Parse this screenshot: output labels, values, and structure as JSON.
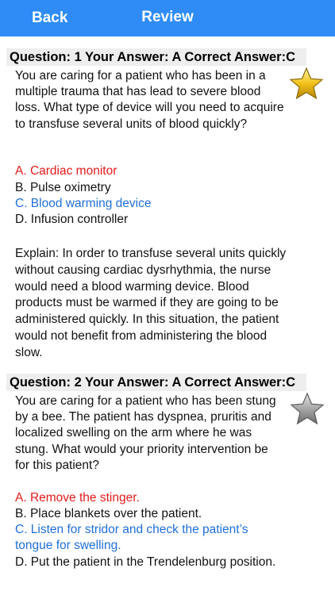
{
  "nav": {
    "back_label": "Back",
    "title": "Review"
  },
  "questions": [
    {
      "header": "Question: 1 Your Answer: A Correct Answer:C",
      "text": "You are caring for a patient who has been in a multiple trauma that has lead to severe blood loss. What type of device will you need to acquire to transfuse several units of blood quickly?",
      "options": [
        {
          "label": "A. Cardiac monitor",
          "state": "wrong"
        },
        {
          "label": "B. Pulse oximetry",
          "state": "neutral"
        },
        {
          "label": "C. Blood warming device",
          "state": "correct"
        },
        {
          "label": "D. Infusion controller",
          "state": "neutral"
        }
      ],
      "explain": "Explain: In order to transfuse several units quickly without causing cardiac dysrhythmia, the nurse would need a blood warming device. Blood products must be warmed if they are going to be administered quickly. In this situation, the patient would not benefit from administering the blood slow.",
      "star": "gold-star-icon"
    },
    {
      "header": "Question: 2 Your Answer: A Correct Answer:C",
      "text": "You are caring for a patient who has been stung by a bee. The patient has dyspnea, pruritis and localized swelling on the arm where he was stung. What would your priority intervention be for this patient?",
      "options": [
        {
          "label": "A. Remove the stinger.",
          "state": "wrong"
        },
        {
          "label": "B. Place blankets over the patient.",
          "state": "neutral"
        },
        {
          "label": "C. Listen for stridor and check the patient’s tongue for swelling.",
          "state": "correct"
        },
        {
          "label": "D. Put the patient in the Trendelenburg position.",
          "state": "neutral"
        }
      ],
      "star": "gray-star-icon"
    }
  ],
  "colors": {
    "nav": "#2f8cf7",
    "wrong": "#e21b1b",
    "correct": "#1f6fd8",
    "header_bg": "#eeeeee"
  }
}
